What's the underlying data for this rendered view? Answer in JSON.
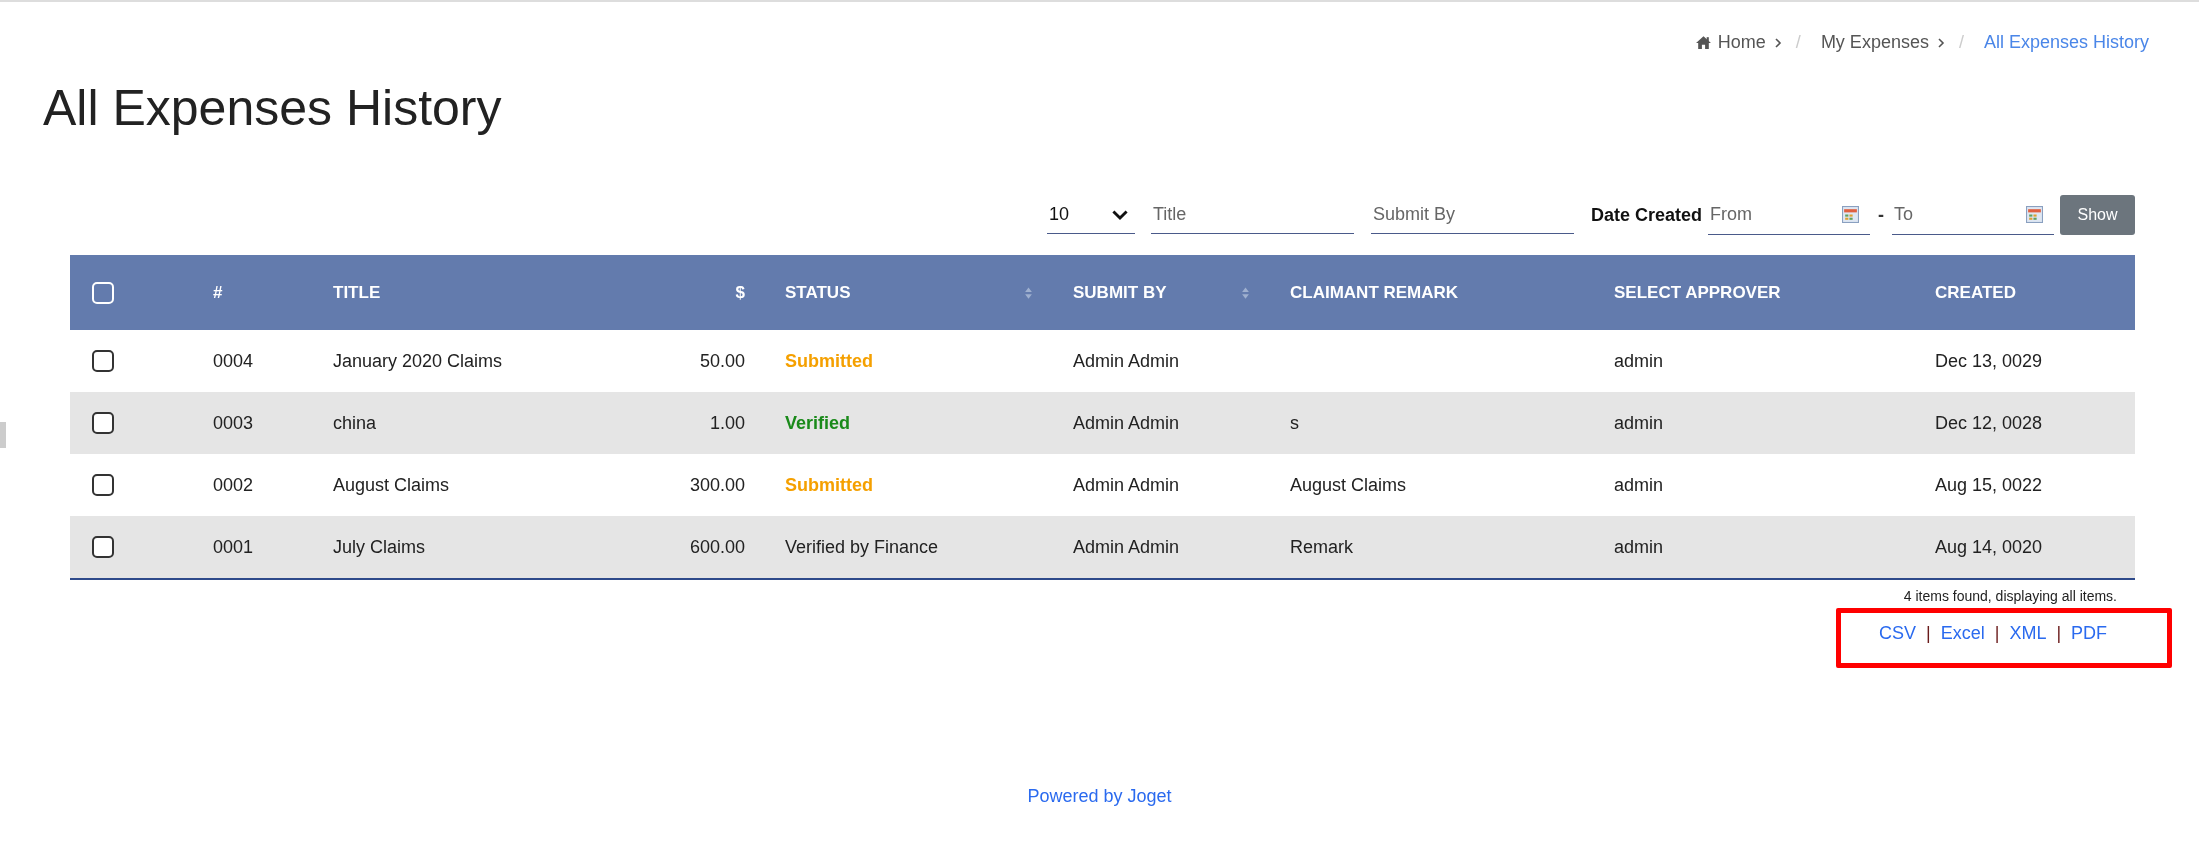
{
  "breadcrumb": [
    {
      "label": "Home",
      "current": false
    },
    {
      "label": "My Expenses",
      "current": false
    },
    {
      "label": "All Expenses History",
      "current": true
    }
  ],
  "breadcrumb_separator": "/",
  "page_title": "All Expenses History",
  "filters": {
    "page_size": "10",
    "title_placeholder": "Title",
    "submit_by_placeholder": "Submit By",
    "date_label": "Date Created",
    "from_placeholder": "From",
    "separator": "-",
    "to_placeholder": "To",
    "show_button": "Show"
  },
  "table": {
    "select_all_checked": false,
    "columns": [
      {
        "label": "#",
        "sortable": false,
        "numeric": false
      },
      {
        "label": "TITLE",
        "sortable": false,
        "numeric": false
      },
      {
        "label": "$",
        "sortable": false,
        "numeric": true
      },
      {
        "label": "STATUS",
        "sortable": true,
        "numeric": false
      },
      {
        "label": "SUBMIT BY",
        "sortable": true,
        "numeric": false
      },
      {
        "label": "CLAIMANT REMARK",
        "sortable": false,
        "numeric": false
      },
      {
        "label": "SELECT APPROVER",
        "sortable": false,
        "numeric": false
      },
      {
        "label": "CREATED",
        "sortable": false,
        "numeric": false
      }
    ],
    "rows": [
      {
        "checked": false,
        "id": "0004",
        "title": "January 2020 Claims",
        "amount": "50.00",
        "status": {
          "text": "Submitted",
          "kind": "submitted"
        },
        "submit_by": "Admin Admin",
        "remark": "",
        "approver": "admin",
        "created": "Dec 13, 0029"
      },
      {
        "checked": false,
        "id": "0003",
        "title": "china",
        "amount": "1.00",
        "status": {
          "text": "Verified",
          "kind": "verified"
        },
        "submit_by": "Admin Admin",
        "remark": "s",
        "approver": "admin",
        "created": "Dec 12, 0028"
      },
      {
        "checked": false,
        "id": "0002",
        "title": "August Claims",
        "amount": "300.00",
        "status": {
          "text": "Submitted",
          "kind": "submitted"
        },
        "submit_by": "Admin Admin",
        "remark": "August Claims",
        "approver": "admin",
        "created": "Aug 15, 0022"
      },
      {
        "checked": false,
        "id": "0001",
        "title": "July Claims",
        "amount": "600.00",
        "status": {
          "text": "Verified by Finance",
          "kind": "plain"
        },
        "submit_by": "Admin Admin",
        "remark": "Remark",
        "approver": "admin",
        "created": "Aug 14, 0020"
      }
    ]
  },
  "result_summary": "4 items found, displaying all items.",
  "export_links": [
    "CSV",
    "Excel",
    "XML",
    "PDF"
  ],
  "export_separator": "|",
  "footer": "Powered by Joget"
}
